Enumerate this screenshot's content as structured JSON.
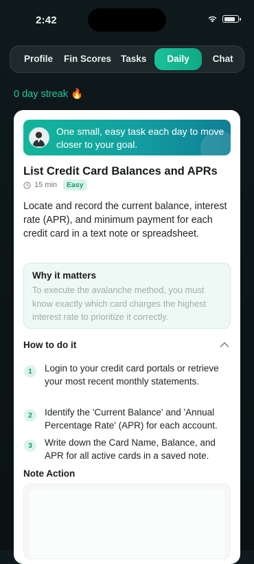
{
  "status": {
    "time": "2:42"
  },
  "tabs": [
    {
      "label": "Profile",
      "active": false
    },
    {
      "label": "Fin Scores",
      "active": false
    },
    {
      "label": "Tasks",
      "active": false
    },
    {
      "label": "Daily",
      "active": true
    },
    {
      "label": "Chat",
      "active": false
    }
  ],
  "streak": {
    "text": "0 day streak",
    "emoji": "🔥"
  },
  "banner": {
    "text": "One small, easy task each day to move closer to your goal."
  },
  "task": {
    "title": "List Credit Card Balances and APRs",
    "duration": "15 min",
    "difficulty": "Easy",
    "description": "Locate and record the current balance, interest rate (APR), and minimum payment for each credit card in a text note or spreadsheet."
  },
  "why": {
    "title": "Why it matters",
    "text": "To execute the avalanche method, you must know exactly which card charges the highest interest rate to prioritize it correctly."
  },
  "how": {
    "title": "How to do it",
    "steps": [
      {
        "num": "1",
        "text": "Login to your credit card portals or retrieve your most recent monthly statements."
      },
      {
        "num": "2",
        "text": "Identify the 'Current Balance' and 'Annual Percentage Rate' (APR) for each account."
      },
      {
        "num": "3",
        "text": "Write down the Card Name, Balance, and APR for all active cards in a saved note."
      }
    ]
  },
  "note": {
    "title": "Note Action",
    "value": ""
  },
  "colors": {
    "accent": "#19c29a",
    "background": "#0f1a1d"
  }
}
